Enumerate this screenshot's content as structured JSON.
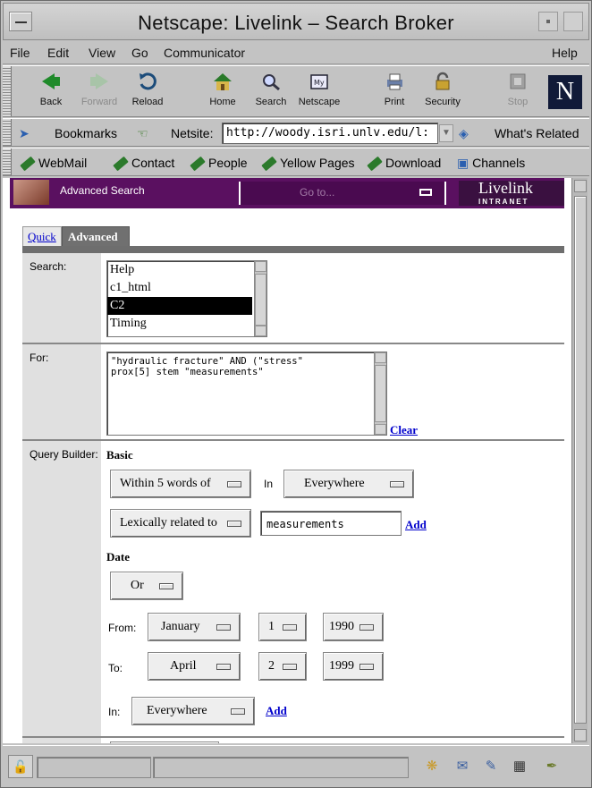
{
  "window": {
    "title": "Netscape: Livelink – Search Broker"
  },
  "menu": {
    "file": "File",
    "edit": "Edit",
    "view": "View",
    "go": "Go",
    "communicator": "Communicator",
    "help": "Help"
  },
  "toolbar": {
    "back": "Back",
    "forward": "Forward",
    "reload": "Reload",
    "home": "Home",
    "search": "Search",
    "netscape": "Netscape",
    "print": "Print",
    "security": "Security",
    "stop": "Stop",
    "logo": "N",
    "my_icon": "My"
  },
  "location": {
    "bookmarks": "Bookmarks",
    "netsite_label": "Netsite:",
    "url": "http://woody.isri.unlv.edu/l:",
    "whats_related": "What's Related"
  },
  "personal": {
    "webmail": "WebMail",
    "contact": "Contact",
    "people": "People",
    "yellow_pages": "Yellow Pages",
    "download": "Download",
    "channels": "Channels"
  },
  "banner": {
    "title": "Advanced Search",
    "goto": "Go to...",
    "brand": "Livelink",
    "brand_sub": "INTRANET"
  },
  "tabs": {
    "quick": "Quick",
    "advanced": "Advanced"
  },
  "search": {
    "label": "Search:",
    "options": [
      "Help",
      "c1_html",
      "C2",
      "Timing"
    ],
    "selected_index": 2
  },
  "for": {
    "label": "For:",
    "query": "\"hydraulic fracture\" AND (\"stress\"\nprox[5] stem \"measurements\"",
    "clear": "Clear"
  },
  "query_builder": {
    "label": "Query Builder:",
    "basic_heading": "Basic",
    "proximity": "Within 5 words of",
    "in_label": "In",
    "in_value": "Everywhere",
    "relation": "Lexically related to",
    "term": "measurements",
    "add": "Add",
    "date_heading": "Date",
    "date_op": "Or",
    "from_label": "From:",
    "from_month": "January",
    "from_day": "1",
    "from_year": "1990",
    "to_label": "To:",
    "to_month": "April",
    "to_day": "2",
    "to_year": "1999",
    "date_in_label": "In:",
    "date_in_value": "Everywhere",
    "date_add": "Add"
  }
}
